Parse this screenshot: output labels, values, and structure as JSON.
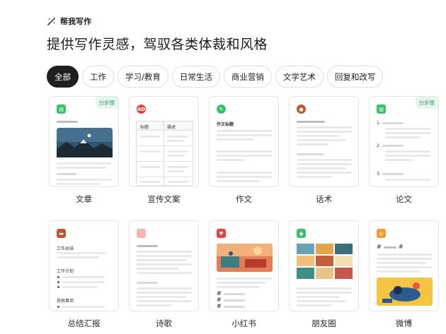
{
  "header": {
    "kicker": "帮我写作",
    "headline": "提供写作灵感，驾驭各类体裁和风格"
  },
  "tabs": [
    {
      "label": "全部",
      "active": true
    },
    {
      "label": "工作",
      "active": false
    },
    {
      "label": "学习/教育",
      "active": false
    },
    {
      "label": "日常生活",
      "active": false
    },
    {
      "label": "商业营销",
      "active": false
    },
    {
      "label": "文学艺术",
      "active": false
    },
    {
      "label": "回复和改写",
      "active": false
    }
  ],
  "badge_label": "分步骤",
  "cards": {
    "article": {
      "label": "文章",
      "icon": "document-icon",
      "color": "#3cbf6f"
    },
    "promo": {
      "label": "宣传文案",
      "icon": "ad-icon",
      "color": "#e8423f",
      "icon_text": "AD",
      "table_header": [
        "标题",
        "描述"
      ]
    },
    "essay": {
      "label": "作文",
      "icon": "pencil-icon",
      "color": "#3cbf6f",
      "title": "作文标题"
    },
    "speech": {
      "label": "话术",
      "icon": "person-icon",
      "color": "#c0562f"
    },
    "thesis": {
      "label": "论文",
      "icon": "book-icon",
      "color": "#3cbf6f",
      "numbers": [
        "1.",
        "2.",
        "3."
      ]
    },
    "summary": {
      "label": "总结汇报",
      "icon": "briefcase-icon",
      "color": "#c0562f",
      "sections": [
        "工作总结",
        "工作计划",
        "其他事项"
      ]
    },
    "poem": {
      "label": "诗歌",
      "icon": "feather-icon",
      "color": "#f4b6b0"
    },
    "xiaohongshu": {
      "label": "小红书",
      "icon": "heart-icon",
      "color": "#e8423f"
    },
    "moments": {
      "label": "朋友圈",
      "icon": "camera-icon",
      "color": "#3cbf6f"
    },
    "weibo": {
      "label": "微博",
      "icon": "eye-icon",
      "color": "#f39b2f"
    }
  },
  "colors": {
    "accent_dark": "#1f1f1f",
    "badge_green": "#2f9e62"
  }
}
